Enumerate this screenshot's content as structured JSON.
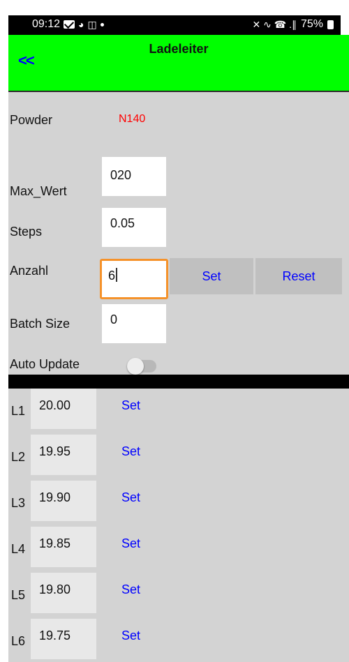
{
  "status_bar": {
    "time": "09:12",
    "battery": "75%",
    "signal_glyphs": "✕ ∿ ☎ .∥"
  },
  "app_bar": {
    "back_label": "<<",
    "title": "Ladeleiter",
    "background_color": "#00ff00"
  },
  "form": {
    "powder_label": "Powder",
    "powder_value": "N140",
    "max_wert_label": "Max_Wert",
    "max_wert_value": "020",
    "steps_label": "Steps",
    "steps_value": "0.05",
    "anzahl_label": "Anzahl",
    "anzahl_value": "6",
    "set_label": "Set",
    "reset_label": "Reset",
    "batch_size_label": "Batch Size",
    "batch_size_value": "0",
    "auto_update_label": "Auto Update",
    "auto_update_on": false
  },
  "levels": [
    {
      "label": "L1",
      "value": "20.00",
      "set_label": "Set"
    },
    {
      "label": "L2",
      "value": "19.95",
      "set_label": "Set"
    },
    {
      "label": "L3",
      "value": "19.90",
      "set_label": "Set"
    },
    {
      "label": "L4",
      "value": "19.85",
      "set_label": "Set"
    },
    {
      "label": "L5",
      "value": "19.80",
      "set_label": "Set"
    },
    {
      "label": "L6",
      "value": "19.75",
      "set_label": "Set"
    }
  ]
}
